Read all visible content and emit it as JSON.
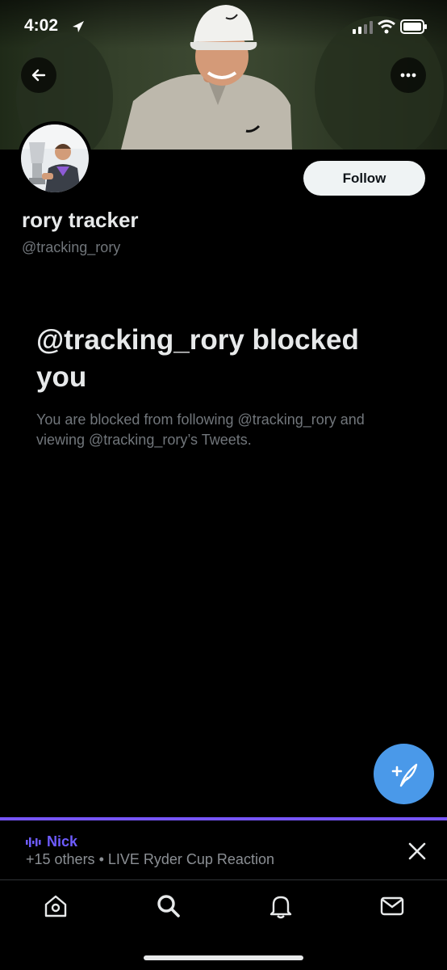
{
  "status_bar": {
    "time": "4:02"
  },
  "profile": {
    "display_name": "rory tracker",
    "handle": "@tracking_rory",
    "follow_label": "Follow"
  },
  "blocked": {
    "title": "@tracking_rory blocked you",
    "message": "You are blocked from following @tracking_rory and viewing @tracking_rory’s Tweets."
  },
  "space": {
    "host": "Nick",
    "description": "+15 others • LIVE Ryder Cup Reaction"
  },
  "colors": {
    "background": "#000000",
    "follow_button": "#eff3f4",
    "fab": "#4a99e9",
    "space_accent": "#7856ff",
    "secondary_text": "#71767b"
  },
  "icons": [
    "back-arrow-icon",
    "more-icon",
    "compose-icon",
    "close-icon",
    "home-icon",
    "search-icon",
    "notifications-icon",
    "messages-icon",
    "location-arrow-icon",
    "signal-icon",
    "wifi-icon",
    "battery-icon",
    "audio-wave-icon"
  ]
}
